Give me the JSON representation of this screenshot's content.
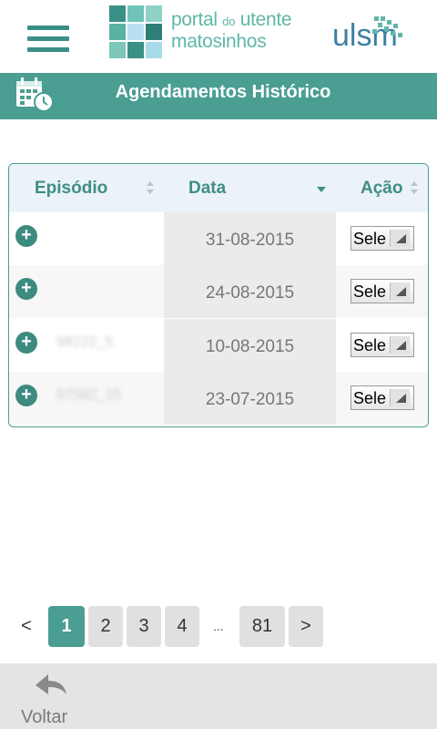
{
  "header": {
    "menu_icon": "hamburger-menu-icon",
    "logo_line1": "portal",
    "logo_do": "do",
    "logo_utente": "utente",
    "logo_line2": "matosinhos",
    "ulsm_logo_text": "ulsm",
    "colors": {
      "brand_teal": "#4a9e92",
      "logo_text": "#5fb7a8"
    }
  },
  "titlebar": {
    "icon": "calendar-clock-icon",
    "title": "Agendamentos Histórico"
  },
  "table": {
    "columns": [
      {
        "label": "Episódio",
        "sort_icon": "sort-both-icon"
      },
      {
        "label": "Data",
        "sort_icon": "sort-desc-icon"
      },
      {
        "label": "Ação",
        "sort_icon": "sort-both-icon"
      }
    ],
    "rows": [
      {
        "episode": "",
        "date": "31-08-2015",
        "action": "Selecionar"
      },
      {
        "episode": "",
        "date": "24-08-2015",
        "action": "Selecionar"
      },
      {
        "episode": "98222_5",
        "date": "10-08-2015",
        "action": "Selecionar"
      },
      {
        "episode": "97582_15",
        "date": "23-07-2015",
        "action": "Selecionar"
      }
    ],
    "expand_symbol": "+"
  },
  "pagination": {
    "prev": "<",
    "pages": [
      "1",
      "2",
      "3",
      "4"
    ],
    "ellipsis": "...",
    "last": "81",
    "next": ">",
    "current": "1"
  },
  "footer": {
    "back_icon": "back-arrow-icon",
    "back_label": "Voltar"
  }
}
